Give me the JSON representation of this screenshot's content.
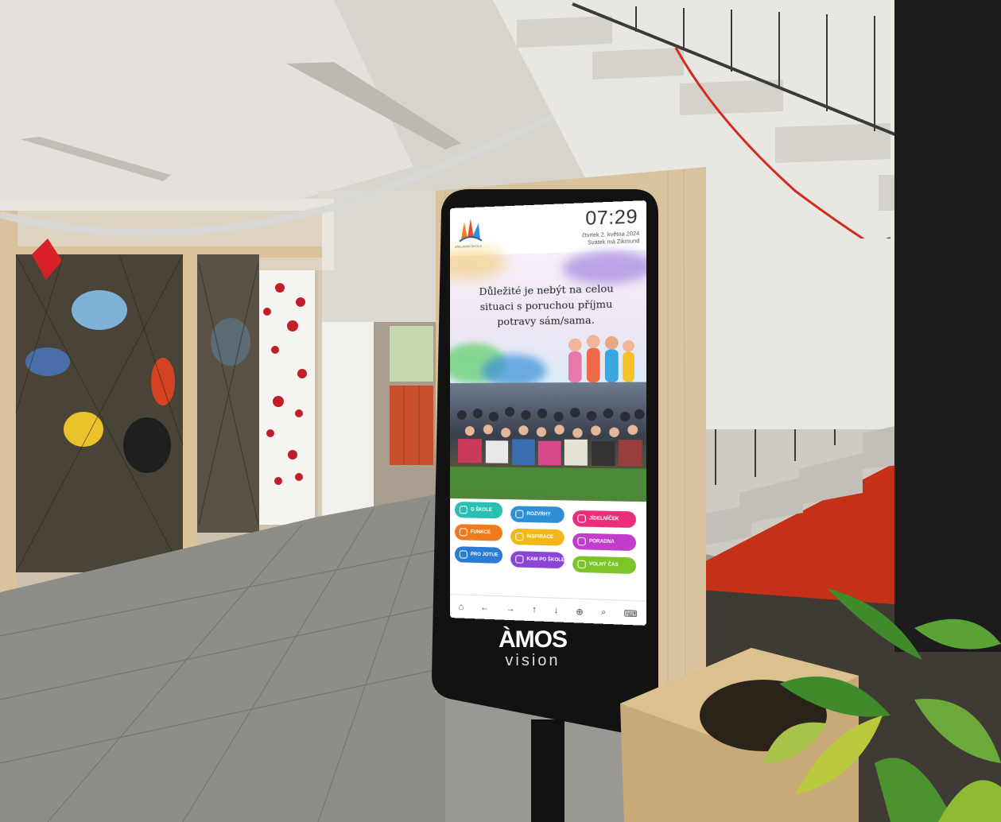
{
  "kiosk": {
    "clock": "07:29",
    "date_line_1": "čtvrtek 2. května 2024",
    "date_line_2": "Svátek má Zikmund",
    "logo_text": "ZÁKLADNÍ ŠKOLA",
    "quote": "Důležité je nebýt na celou situaci s poruchou příjmu potravy sám/sama.",
    "tiles": [
      {
        "label": "O ŠKOLE",
        "color": "#2bbfb3"
      },
      {
        "label": "ROZVRHY",
        "color": "#2d8fd8"
      },
      {
        "label": "JÍDELNÍČEK",
        "color": "#ea2e7b"
      },
      {
        "label": "FUNKCE",
        "color": "#f07a1e"
      },
      {
        "label": "INSPIRACE",
        "color": "#f2b81b"
      },
      {
        "label": "PORADNA",
        "color": "#c33ccb"
      },
      {
        "label": "PRO JOTUE",
        "color": "#2c7bd3"
      },
      {
        "label": "KAM PO ŠKOLE",
        "color": "#8a45d6"
      },
      {
        "label": "VOLNÝ ČAS",
        "color": "#7cc428"
      }
    ],
    "nav": [
      "⌂",
      "←",
      "→",
      "↑",
      "↓",
      "⊕",
      "⌕",
      "⌨"
    ]
  },
  "brand": {
    "line1": "ÀMOS",
    "line2": "vision"
  }
}
